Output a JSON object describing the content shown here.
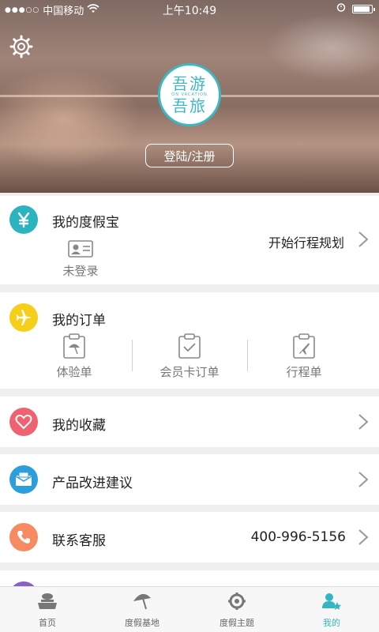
{
  "status_bar": {
    "signal_dots": "●●●○○",
    "carrier": "中国移动",
    "time": "上午10:49"
  },
  "header": {
    "logo_line1": "吾游",
    "logo_line2": "吾旅",
    "logo_tagline": "ON VACATION",
    "login_label": "登陆/注册"
  },
  "vacation_treasure": {
    "title": "我的度假宝",
    "status": "未登录",
    "action_label": "开始行程规划",
    "icon_color": "#2bb3c0"
  },
  "orders": {
    "title": "我的订单",
    "icon_color": "#f5cf1a",
    "items": [
      {
        "label": "体验单"
      },
      {
        "label": "会员卡订单"
      },
      {
        "label": "行程单"
      }
    ]
  },
  "favorites": {
    "title": "我的收藏",
    "icon_color": "#f06270"
  },
  "feedback": {
    "title": "产品改进建议",
    "icon_color": "#2a9fdc"
  },
  "service": {
    "title": "联系客服",
    "phone": "400-996-5156",
    "icon_color": "#f78a60"
  },
  "tabbar": {
    "tabs": [
      {
        "label": "首页",
        "icon": "home-icon"
      },
      {
        "label": "度假基地",
        "icon": "umbrella-icon"
      },
      {
        "label": "度假主题",
        "icon": "gear-icon"
      },
      {
        "label": "我的",
        "icon": "profile-icon"
      }
    ],
    "active_color": "#35b5c2"
  }
}
